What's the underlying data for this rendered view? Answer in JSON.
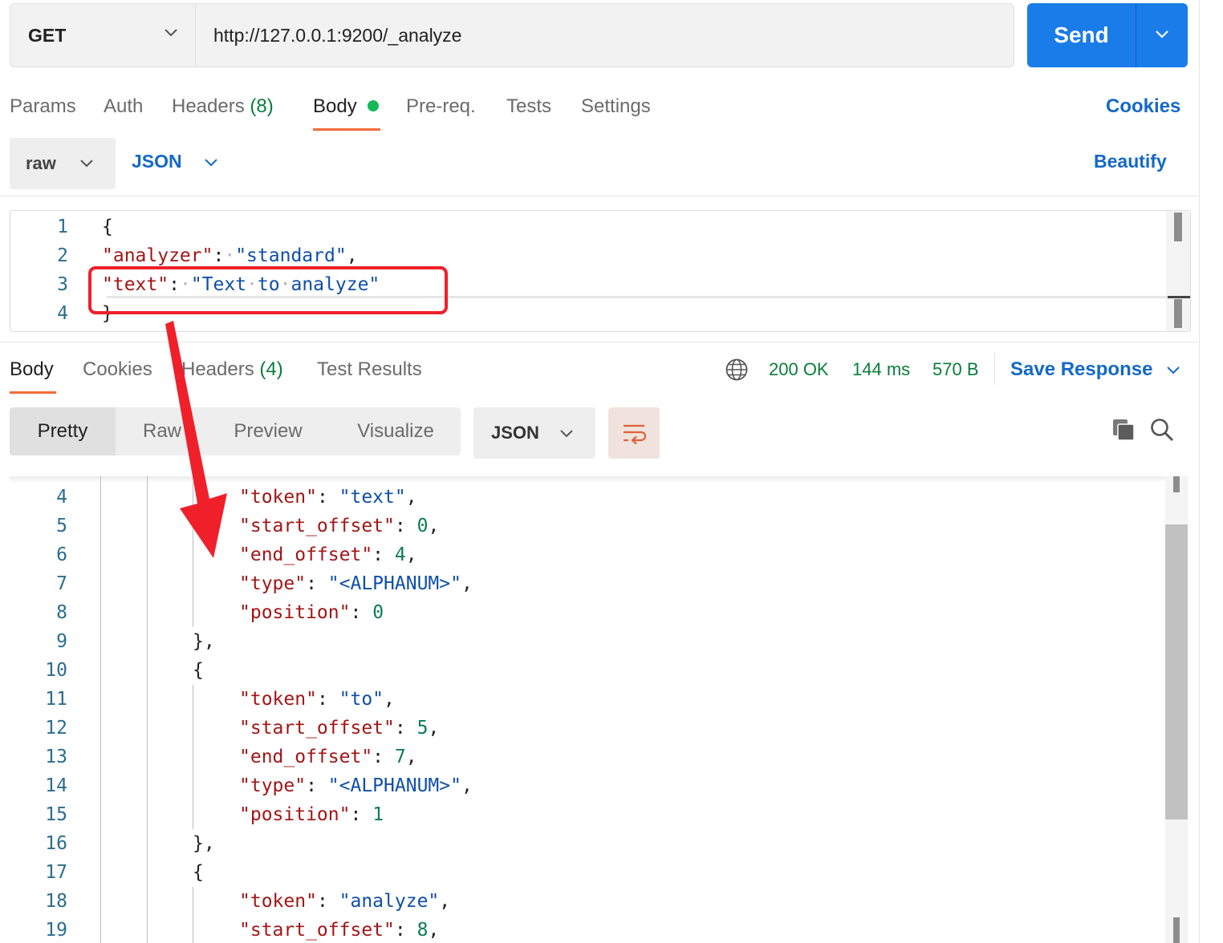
{
  "request": {
    "method": "GET",
    "url": "http://127.0.0.1:9200/_analyze",
    "send_label": "Send"
  },
  "request_tabs": [
    {
      "label": "Params"
    },
    {
      "label": "Auth"
    },
    {
      "label": "Headers",
      "count": "(8)"
    },
    {
      "label": "Body"
    },
    {
      "label": "Pre-req."
    },
    {
      "label": "Tests"
    },
    {
      "label": "Settings"
    }
  ],
  "cookies_link": "Cookies",
  "body_mode": "raw",
  "body_format": "JSON",
  "beautify_label": "Beautify",
  "request_body": {
    "line_numbers": [
      "1",
      "2",
      "3",
      "4"
    ],
    "lines": [
      [
        {
          "t": "{",
          "c": "p"
        }
      ],
      [
        {
          "t": "\"analyzer\"",
          "c": "k"
        },
        {
          "t": ":",
          "c": "p"
        },
        {
          "t": "·",
          "c": "ws"
        },
        {
          "t": "\"standard\"",
          "c": "s"
        },
        {
          "t": ",",
          "c": "p"
        }
      ],
      [
        {
          "t": "\"text\"",
          "c": "k"
        },
        {
          "t": ":",
          "c": "p"
        },
        {
          "t": "·",
          "c": "ws"
        },
        {
          "t": "\"Text",
          "c": "s"
        },
        {
          "t": "·",
          "c": "ws"
        },
        {
          "t": "to",
          "c": "s"
        },
        {
          "t": "·",
          "c": "ws"
        },
        {
          "t": "analyze\"",
          "c": "s"
        }
      ],
      [
        {
          "t": "}",
          "c": "p"
        }
      ]
    ]
  },
  "response_tabs": [
    {
      "label": "Body"
    },
    {
      "label": "Cookies"
    },
    {
      "label": "Headers",
      "count": "(4)"
    },
    {
      "label": "Test Results"
    }
  ],
  "response_status": {
    "status": "200 OK",
    "time": "144 ms",
    "size": "570 B",
    "save_label": "Save Response"
  },
  "view_modes": [
    "Pretty",
    "Raw",
    "Preview",
    "Visualize"
  ],
  "response_format": "JSON",
  "response_body": {
    "line_numbers": [
      "4",
      "5",
      "6",
      "7",
      "8",
      "9",
      "10",
      "11",
      "12",
      "13",
      "14",
      "15",
      "16",
      "17",
      "18",
      "19"
    ],
    "lines": [
      {
        "indent": 3,
        "parts": [
          {
            "t": "\"token\"",
            "c": "k"
          },
          {
            "t": ": ",
            "c": "p"
          },
          {
            "t": "\"text\"",
            "c": "s"
          },
          {
            "t": ",",
            "c": "p"
          }
        ]
      },
      {
        "indent": 3,
        "parts": [
          {
            "t": "\"start_offset\"",
            "c": "k"
          },
          {
            "t": ": ",
            "c": "p"
          },
          {
            "t": "0",
            "c": "n"
          },
          {
            "t": ",",
            "c": "p"
          }
        ]
      },
      {
        "indent": 3,
        "parts": [
          {
            "t": "\"end_offset\"",
            "c": "k"
          },
          {
            "t": ": ",
            "c": "p"
          },
          {
            "t": "4",
            "c": "n"
          },
          {
            "t": ",",
            "c": "p"
          }
        ]
      },
      {
        "indent": 3,
        "parts": [
          {
            "t": "\"type\"",
            "c": "k"
          },
          {
            "t": ": ",
            "c": "p"
          },
          {
            "t": "\"<ALPHANUM>\"",
            "c": "s"
          },
          {
            "t": ",",
            "c": "p"
          }
        ]
      },
      {
        "indent": 3,
        "parts": [
          {
            "t": "\"position\"",
            "c": "k"
          },
          {
            "t": ": ",
            "c": "p"
          },
          {
            "t": "0",
            "c": "n"
          }
        ]
      },
      {
        "indent": 2,
        "parts": [
          {
            "t": "},",
            "c": "p"
          }
        ]
      },
      {
        "indent": 2,
        "parts": [
          {
            "t": "{",
            "c": "p"
          }
        ]
      },
      {
        "indent": 3,
        "parts": [
          {
            "t": "\"token\"",
            "c": "k"
          },
          {
            "t": ": ",
            "c": "p"
          },
          {
            "t": "\"to\"",
            "c": "s"
          },
          {
            "t": ",",
            "c": "p"
          }
        ]
      },
      {
        "indent": 3,
        "parts": [
          {
            "t": "\"start_offset\"",
            "c": "k"
          },
          {
            "t": ": ",
            "c": "p"
          },
          {
            "t": "5",
            "c": "n"
          },
          {
            "t": ",",
            "c": "p"
          }
        ]
      },
      {
        "indent": 3,
        "parts": [
          {
            "t": "\"end_offset\"",
            "c": "k"
          },
          {
            "t": ": ",
            "c": "p"
          },
          {
            "t": "7",
            "c": "n"
          },
          {
            "t": ",",
            "c": "p"
          }
        ]
      },
      {
        "indent": 3,
        "parts": [
          {
            "t": "\"type\"",
            "c": "k"
          },
          {
            "t": ": ",
            "c": "p"
          },
          {
            "t": "\"<ALPHANUM>\"",
            "c": "s"
          },
          {
            "t": ",",
            "c": "p"
          }
        ]
      },
      {
        "indent": 3,
        "parts": [
          {
            "t": "\"position\"",
            "c": "k"
          },
          {
            "t": ": ",
            "c": "p"
          },
          {
            "t": "1",
            "c": "n"
          }
        ]
      },
      {
        "indent": 2,
        "parts": [
          {
            "t": "},",
            "c": "p"
          }
        ]
      },
      {
        "indent": 2,
        "parts": [
          {
            "t": "{",
            "c": "p"
          }
        ]
      },
      {
        "indent": 3,
        "parts": [
          {
            "t": "\"token\"",
            "c": "k"
          },
          {
            "t": ": ",
            "c": "p"
          },
          {
            "t": "\"analyze\"",
            "c": "s"
          },
          {
            "t": ",",
            "c": "p"
          }
        ]
      },
      {
        "indent": 3,
        "parts": [
          {
            "t": "\"start_offset\"",
            "c": "k"
          },
          {
            "t": ": ",
            "c": "p"
          },
          {
            "t": "8",
            "c": "n"
          },
          {
            "t": ",",
            "c": "p"
          }
        ]
      }
    ]
  },
  "colors": {
    "accent_blue": "#1a7ce8",
    "tab_underline": "#f26b3a",
    "status_green": "#0a7d3b",
    "annotation_red": "#f0202a"
  },
  "icons": [
    "chevron-down-icon",
    "globe-icon",
    "wrap-lines-icon",
    "copy-icon",
    "search-icon"
  ]
}
